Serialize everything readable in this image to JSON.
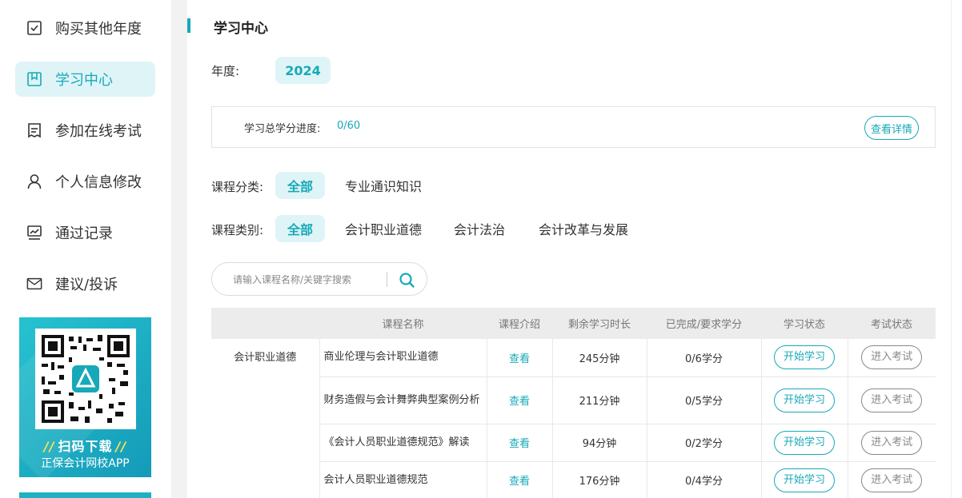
{
  "sidebar": {
    "items": [
      {
        "label": "购买其他年度",
        "icon": "checkbox-icon",
        "active": false
      },
      {
        "label": "学习中心",
        "icon": "bookmark-icon",
        "active": true
      },
      {
        "label": "参加在线考试",
        "icon": "exam-doc-icon",
        "active": false
      },
      {
        "label": "个人信息修改",
        "icon": "user-icon",
        "active": false
      },
      {
        "label": "通过记录",
        "icon": "chart-icon",
        "active": false
      },
      {
        "label": "建议/投诉",
        "icon": "mail-icon",
        "active": false
      }
    ],
    "promo": {
      "headline": "扫码下载",
      "subline": "正保会计网校APP"
    }
  },
  "main": {
    "title": "学习中心",
    "year_label": "年度:",
    "year_value": "2024",
    "progress": {
      "label": "学习总学分进度:",
      "value": "0/60",
      "detail_button": "查看详情"
    },
    "category": {
      "label": "课程分类:",
      "options": [
        "全部",
        "专业通识知识"
      ],
      "selected": "全部"
    },
    "type": {
      "label": "课程类别:",
      "options": [
        "全部",
        "会计职业道德",
        "会计法治",
        "会计改革与发展"
      ],
      "selected": "全部"
    },
    "search": {
      "placeholder": "请输入课程名称/关键字搜索"
    },
    "table": {
      "headers": [
        "",
        "课程名称",
        "课程介绍",
        "剩余学习时长",
        "已完成/要求学分",
        "学习状态",
        "考试状态"
      ],
      "group": "会计职业道德",
      "rows": [
        {
          "name": "商业伦理与会计职业道德",
          "intro": "查看",
          "remaining": "245分钟",
          "credits": "0/6学分",
          "study": "开始学习",
          "exam": "进入考试"
        },
        {
          "name": "财务造假与会计舞弊典型案例分析",
          "intro": "查看",
          "remaining": "211分钟",
          "credits": "0/5学分",
          "study": "开始学习",
          "exam": "进入考试"
        },
        {
          "name": "《会计人员职业道德规范》解读",
          "intro": "查看",
          "remaining": "94分钟",
          "credits": "0/2学分",
          "study": "开始学习",
          "exam": "进入考试"
        },
        {
          "name": "会计人员职业道德规范",
          "intro": "查看",
          "remaining": "176分钟",
          "credits": "0/4学分",
          "study": "开始学习",
          "exam": "进入考试"
        }
      ]
    }
  },
  "colors": {
    "accent": "#17a9b8",
    "accent_bg": "#dff4f7"
  }
}
